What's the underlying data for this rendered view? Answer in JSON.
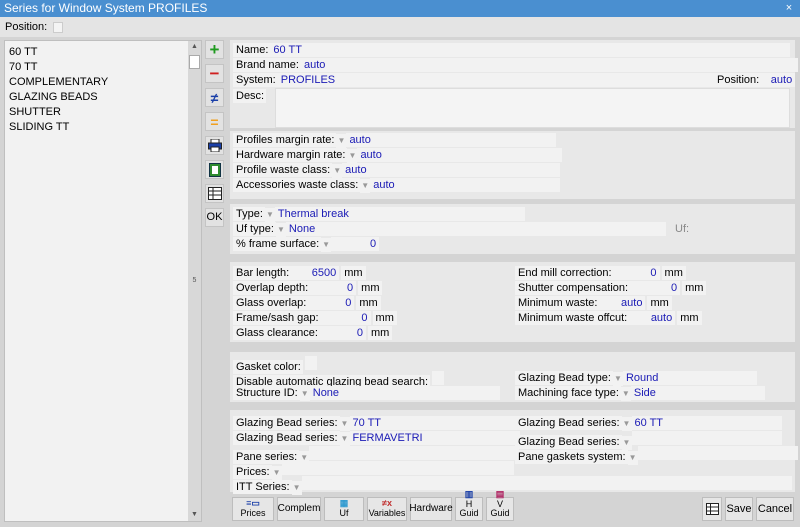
{
  "window": {
    "title": "Series for Window System PROFILES",
    "close_glyph": "×"
  },
  "topbar": {
    "position_label": "Position:"
  },
  "series_list": [
    "60 TT",
    "70 TT",
    "COMPLEMENTARY",
    "GLAZING BEADS",
    "SHUTTER",
    "SLIDING TT"
  ],
  "scrollbar": {
    "mid_marker": "5"
  },
  "toolbar": {
    "ok_label": "OK"
  },
  "header": {
    "name_label": "Name:",
    "name_value": "60 TT",
    "brand_label": "Brand name:",
    "brand_value": "auto",
    "system_label": "System:",
    "system_value": "PROFILES",
    "position_label": "Position:",
    "position_value": "auto",
    "desc_label": "Desc:"
  },
  "rates": {
    "profiles_margin_label": "Profiles margin rate:",
    "profiles_margin_value": "auto",
    "hardware_margin_label": "Hardware margin rate:",
    "hardware_margin_value": "auto",
    "profile_waste_label": "Profile waste class:",
    "profile_waste_value": "auto",
    "accessories_waste_label": "Accessories waste class:",
    "accessories_waste_value": "auto"
  },
  "type_section": {
    "type_label": "Type:",
    "type_value": "Thermal break",
    "uf_type_label": "Uf type:",
    "uf_type_value": "None",
    "uf_label": "Uf:",
    "frame_surface_label": "% frame surface:",
    "frame_surface_value": "0"
  },
  "dimensions": {
    "bar_length_label": "Bar length:",
    "bar_length_value": "6500",
    "overlap_depth_label": "Overlap depth:",
    "overlap_depth_value": "0",
    "glass_overlap_label": "Glass overlap:",
    "glass_overlap_value": "0",
    "frame_sash_gap_label": "Frame/sash gap:",
    "frame_sash_gap_value": "0",
    "glass_clearance_label": "Glass clearance:",
    "glass_clearance_value": "0",
    "end_mill_label": "End mill correction:",
    "end_mill_value": "0",
    "shutter_comp_label": "Shutter compensation:",
    "shutter_comp_value": "0",
    "min_waste_label": "Minimum waste:",
    "min_waste_value": "auto",
    "min_waste_offcut_label": "Minimum waste offcut:",
    "min_waste_offcut_value": "auto",
    "unit": "mm"
  },
  "gasket_section": {
    "gasket_color_label": "Gasket color:",
    "disable_auto_label": "Disable automatic glazing bead search:",
    "structure_id_label": "Structure ID:",
    "structure_id_value": "None",
    "bead_type_label": "Glazing Bead type:",
    "bead_type_value": "Round",
    "machining_face_label": "Machining face type:",
    "machining_face_value": "Side"
  },
  "series_section": {
    "bead_series_label": "Glazing Bead series:",
    "left_bead_series_1": "70 TT",
    "left_bead_series_2": "FERMAVETRI",
    "right_bead_series_1": "60 TT",
    "pane_series_label": "Pane series:",
    "pane_gaskets_label": "Pane gaskets system:",
    "prices_label": "Prices:",
    "itt_series_label": "ITT Series:"
  },
  "bottom_buttons": {
    "prices": "Prices",
    "complem": "Complem",
    "uf": "Uf",
    "variables": "Variables",
    "hardware": "Hardware",
    "h_guid": "H Guid",
    "v_guid": "V Guid",
    "save": "Save",
    "cancel": "Cancel"
  },
  "colors": {
    "titlebar": "#4a8fd0",
    "value_text": "#1a1ab5",
    "add_icon": "#1e9a1e",
    "remove_icon": "#d02020",
    "equal_icon": "#f0a020"
  }
}
